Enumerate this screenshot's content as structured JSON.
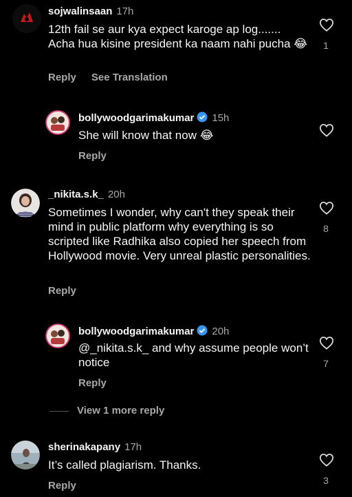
{
  "comments": [
    {
      "username": "sojwalinsaan",
      "time": "17h",
      "text": "12th fail se aur kya expect karoge ap log....... Acha hua kisine president ka naam nahi pucha 😂",
      "actions": [
        "Reply",
        "See Translation"
      ],
      "likes": "1"
    },
    {
      "username": "bollywoodgarimakumar",
      "time": "15h",
      "verified": true,
      "text": "She will know that now 😂",
      "actions": [
        "Reply"
      ],
      "likes": ""
    },
    {
      "username": "_nikita.s.k_",
      "time": "20h",
      "text": "Sometimes I wonder, why can't they speak their mind in public platform why everything is so scripted like Radhika also copied her speech from Hollywood movie. Very unreal plastic personalities.",
      "actions": [
        "Reply"
      ],
      "likes": "8"
    },
    {
      "username": "bollywoodgarimakumar",
      "time": "20h",
      "verified": true,
      "text": "@_nikita.s.k_ and why assume people won’t notice",
      "actions": [
        "Reply"
      ],
      "likes": "7"
    },
    {
      "username": "sherinakapany",
      "time": "17h",
      "text": "It’s called plagiarism. Thanks.",
      "actions": [
        "Reply"
      ],
      "likes": "3"
    }
  ],
  "view_more_label": "View 1 more reply",
  "icons": {
    "like": "heart-outline-icon",
    "verified": "verified-badge-icon"
  },
  "colors": {
    "background": "#000000",
    "text": "#f5f5f5",
    "secondary": "#a8a8a8",
    "verified": "#3797f0"
  }
}
